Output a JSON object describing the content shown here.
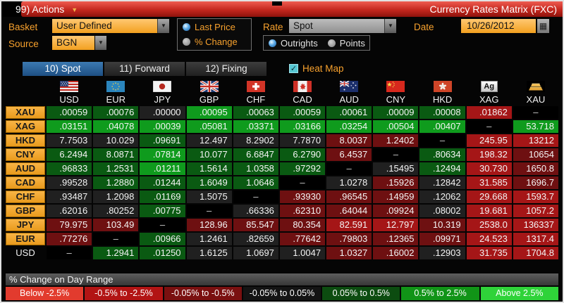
{
  "titlebar": {
    "menu_label": "99) Actions",
    "title": "Currency Rates Matrix (FXC)"
  },
  "controls": {
    "basket_label": "Basket",
    "basket_value": "User Defined",
    "source_label": "Source",
    "source_value": "BGN",
    "price_mode": {
      "options": [
        {
          "label": "Last Price",
          "selected": true
        },
        {
          "label": "% Change",
          "selected": false
        }
      ]
    },
    "rate_label": "Rate",
    "rate_value": "Spot",
    "rate_mode": {
      "options": [
        {
          "label": "Outrights",
          "selected": true
        },
        {
          "label": "Points",
          "selected": false
        }
      ]
    },
    "date_label": "Date",
    "date_value": "10/26/2012"
  },
  "tabs": [
    {
      "label": "10) Spot",
      "active": true
    },
    {
      "label": "11) Forward",
      "active": false
    },
    {
      "label": "12) Fixing",
      "active": false
    }
  ],
  "heat_map": {
    "label": "Heat Map",
    "checked": true,
    "accent": "#58c8d4"
  },
  "matrix": {
    "columns": [
      {
        "code": "USD",
        "icon": "flag-us-icon"
      },
      {
        "code": "EUR",
        "icon": "flag-eu-icon"
      },
      {
        "code": "JPY",
        "icon": "flag-jp-icon"
      },
      {
        "code": "GBP",
        "icon": "flag-gb-icon"
      },
      {
        "code": "CHF",
        "icon": "flag-ch-icon"
      },
      {
        "code": "CAD",
        "icon": "flag-ca-icon"
      },
      {
        "code": "AUD",
        "icon": "flag-au-icon"
      },
      {
        "code": "CNY",
        "icon": "flag-cn-icon"
      },
      {
        "code": "HKD",
        "icon": "flag-hk-icon"
      },
      {
        "code": "XAG",
        "icon": "silver-ag-icon"
      },
      {
        "code": "XAU",
        "icon": "gold-bars-icon"
      }
    ],
    "rows": [
      {
        "label": "XAU",
        "highlighted": true,
        "cells": [
          {
            "v": ".00059",
            "c": "g1"
          },
          {
            "v": ".00076",
            "c": "g1"
          },
          {
            "v": ".00000",
            "c": "n"
          },
          {
            "v": ".00095",
            "c": "g2"
          },
          {
            "v": ".00063",
            "c": "g1"
          },
          {
            "v": ".00059",
            "c": "g1"
          },
          {
            "v": ".00061",
            "c": "g1"
          },
          {
            "v": ".00009",
            "c": "g1"
          },
          {
            "v": ".00008",
            "c": "g1"
          },
          {
            "v": ".01862",
            "c": "r2"
          },
          {
            "v": "–",
            "c": "k"
          }
        ]
      },
      {
        "label": "XAG",
        "highlighted": true,
        "cells": [
          {
            "v": ".03151",
            "c": "g2"
          },
          {
            "v": ".04078",
            "c": "g2"
          },
          {
            "v": ".00039",
            "c": "g2"
          },
          {
            "v": ".05081",
            "c": "g2"
          },
          {
            "v": ".03371",
            "c": "g2"
          },
          {
            "v": ".03166",
            "c": "g2"
          },
          {
            "v": ".03254",
            "c": "g2"
          },
          {
            "v": ".00504",
            "c": "g2"
          },
          {
            "v": ".00407",
            "c": "g2"
          },
          {
            "v": "–",
            "c": "k"
          },
          {
            "v": "53.718",
            "c": "g2"
          }
        ]
      },
      {
        "label": "HKD",
        "highlighted": true,
        "cells": [
          {
            "v": "7.7503",
            "c": "n"
          },
          {
            "v": "10.029",
            "c": "n"
          },
          {
            "v": ".09691",
            "c": "g1"
          },
          {
            "v": "12.497",
            "c": "n"
          },
          {
            "v": "8.2902",
            "c": "n"
          },
          {
            "v": "7.7870",
            "c": "n"
          },
          {
            "v": "8.0037",
            "c": "r1"
          },
          {
            "v": "1.2402",
            "c": "r1"
          },
          {
            "v": "–",
            "c": "k"
          },
          {
            "v": "245.95",
            "c": "r2"
          },
          {
            "v": "13212",
            "c": "r2"
          }
        ]
      },
      {
        "label": "CNY",
        "highlighted": true,
        "cells": [
          {
            "v": "6.2494",
            "c": "g1"
          },
          {
            "v": "8.0871",
            "c": "g1"
          },
          {
            "v": ".07814",
            "c": "g2"
          },
          {
            "v": "10.077",
            "c": "g1"
          },
          {
            "v": "6.6847",
            "c": "g1"
          },
          {
            "v": "6.2790",
            "c": "g1"
          },
          {
            "v": "6.4537",
            "c": "r1"
          },
          {
            "v": "–",
            "c": "k"
          },
          {
            "v": ".80634",
            "c": "g1"
          },
          {
            "v": "198.32",
            "c": "r2"
          },
          {
            "v": "10654",
            "c": "r1"
          }
        ]
      },
      {
        "label": "AUD",
        "highlighted": true,
        "cells": [
          {
            "v": ".96833",
            "c": "g1"
          },
          {
            "v": "1.2531",
            "c": "g1"
          },
          {
            "v": ".01211",
            "c": "g2"
          },
          {
            "v": "1.5614",
            "c": "g1"
          },
          {
            "v": "1.0358",
            "c": "g1"
          },
          {
            "v": ".97292",
            "c": "g1"
          },
          {
            "v": "–",
            "c": "k"
          },
          {
            "v": ".15495",
            "c": "n"
          },
          {
            "v": ".12494",
            "c": "g1"
          },
          {
            "v": "30.730",
            "c": "r2"
          },
          {
            "v": "1650.8",
            "c": "r1"
          }
        ]
      },
      {
        "label": "CAD",
        "highlighted": true,
        "cells": [
          {
            "v": ".99528",
            "c": "n"
          },
          {
            "v": "1.2880",
            "c": "g1"
          },
          {
            "v": ".01244",
            "c": "g1"
          },
          {
            "v": "1.6049",
            "c": "g1"
          },
          {
            "v": "1.0646",
            "c": "g1"
          },
          {
            "v": "–",
            "c": "k"
          },
          {
            "v": "1.0278",
            "c": "n"
          },
          {
            "v": ".15926",
            "c": "r1"
          },
          {
            "v": ".12842",
            "c": "n"
          },
          {
            "v": "31.585",
            "c": "r2"
          },
          {
            "v": "1696.7",
            "c": "r1"
          }
        ]
      },
      {
        "label": "CHF",
        "highlighted": true,
        "cells": [
          {
            "v": ".93487",
            "c": "n"
          },
          {
            "v": "1.2098",
            "c": "n"
          },
          {
            "v": ".01169",
            "c": "g1"
          },
          {
            "v": "1.5075",
            "c": "n"
          },
          {
            "v": "–",
            "c": "k"
          },
          {
            "v": ".93930",
            "c": "r1"
          },
          {
            "v": ".96545",
            "c": "r1"
          },
          {
            "v": ".14959",
            "c": "r1"
          },
          {
            "v": ".12062",
            "c": "n"
          },
          {
            "v": "29.668",
            "c": "r2"
          },
          {
            "v": "1593.7",
            "c": "r2"
          }
        ]
      },
      {
        "label": "GBP",
        "highlighted": true,
        "cells": [
          {
            "v": ".62016",
            "c": "n"
          },
          {
            "v": ".80252",
            "c": "n"
          },
          {
            "v": ".00775",
            "c": "g1"
          },
          {
            "v": "–",
            "c": "k"
          },
          {
            "v": ".66336",
            "c": "n"
          },
          {
            "v": ".62310",
            "c": "r1"
          },
          {
            "v": ".64044",
            "c": "r1"
          },
          {
            "v": ".09924",
            "c": "r1"
          },
          {
            "v": ".08002",
            "c": "n"
          },
          {
            "v": "19.681",
            "c": "r2"
          },
          {
            "v": "1057.2",
            "c": "r2"
          }
        ]
      },
      {
        "label": "JPY",
        "highlighted": true,
        "cells": [
          {
            "v": "79.975",
            "c": "r1"
          },
          {
            "v": "103.49",
            "c": "r1"
          },
          {
            "v": "–",
            "c": "k"
          },
          {
            "v": "128.96",
            "c": "r1"
          },
          {
            "v": "85.547",
            "c": "r1"
          },
          {
            "v": "80.354",
            "c": "r1"
          },
          {
            "v": "82.591",
            "c": "r2"
          },
          {
            "v": "12.797",
            "c": "r2"
          },
          {
            "v": "10.319",
            "c": "r1"
          },
          {
            "v": "2538.0",
            "c": "r2"
          },
          {
            "v": "136337",
            "c": "r2"
          }
        ]
      },
      {
        "label": "EUR",
        "highlighted": true,
        "cells": [
          {
            "v": ".77276",
            "c": "r1"
          },
          {
            "v": "–",
            "c": "k"
          },
          {
            "v": ".00966",
            "c": "g1"
          },
          {
            "v": "1.2461",
            "c": "n"
          },
          {
            "v": ".82659",
            "c": "n"
          },
          {
            "v": ".77642",
            "c": "r1"
          },
          {
            "v": ".79803",
            "c": "r1"
          },
          {
            "v": ".12365",
            "c": "r1"
          },
          {
            "v": ".09971",
            "c": "r1"
          },
          {
            "v": "24.523",
            "c": "r2"
          },
          {
            "v": "1317.4",
            "c": "r2"
          }
        ]
      },
      {
        "label": "USD",
        "highlighted": false,
        "cells": [
          {
            "v": "–",
            "c": "k"
          },
          {
            "v": "1.2941",
            "c": "g1"
          },
          {
            "v": ".01250",
            "c": "g1"
          },
          {
            "v": "1.6125",
            "c": "n"
          },
          {
            "v": "1.0697",
            "c": "n"
          },
          {
            "v": "1.0047",
            "c": "n"
          },
          {
            "v": "1.0327",
            "c": "r1"
          },
          {
            "v": ".16002",
            "c": "r1"
          },
          {
            "v": ".12903",
            "c": "n"
          },
          {
            "v": "31.735",
            "c": "r2"
          },
          {
            "v": "1704.8",
            "c": "r2"
          }
        ]
      }
    ]
  },
  "heat_colors": {
    "g2": "#0f9b1d",
    "g1": "#0a5a12",
    "n": "#202020",
    "r1": "#6e1011",
    "r2": "#a51617",
    "k": "#000000"
  },
  "legend": {
    "title": "% Change on Day Range",
    "ranges": [
      {
        "label": "Below -2.5%",
        "color": "#e23b2e"
      },
      {
        "label": "-0.5% to -2.5%",
        "color": "#b21414"
      },
      {
        "label": "-0.05% to -0.5%",
        "color": "#7a1010"
      },
      {
        "label": "-0.05% to 0.05%",
        "color": "#141414"
      },
      {
        "label": "0.05% to 0.5%",
        "color": "#0c4c10"
      },
      {
        "label": "0.5% to 2.5%",
        "color": "#119417"
      },
      {
        "label": "Above 2.5%",
        "color": "#2fd339"
      }
    ]
  }
}
